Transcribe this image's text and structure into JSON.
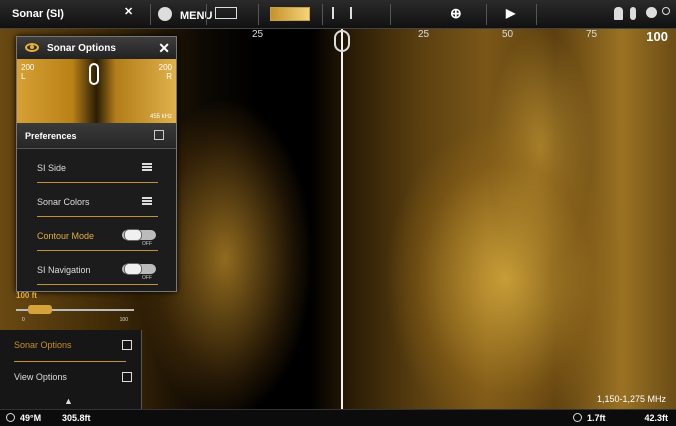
{
  "topbar": {
    "title": "Sonar (SI)",
    "close_glyph": "✕",
    "menu_label": "MENU",
    "play_glyph": "▶",
    "crosshair_glyph": "⊕",
    "icons": [
      "close-icon",
      "menu-icon",
      "chart-icon",
      "sonar-view-icon",
      "transducer-icon",
      "waypoint-icon",
      "play-icon",
      "person-icon",
      "gps-icon",
      "settings-icon"
    ],
    "accent": "#e8b330"
  },
  "scale": {
    "ticks": [
      "25",
      "25",
      "50",
      "75"
    ],
    "max": "100"
  },
  "panel": {
    "title": "Sonar Options",
    "close_glyph": "✕",
    "preview": {
      "left_top": "200",
      "left_unit": "L",
      "right_top": "200",
      "right_unit": "R",
      "freq": "455 kHz"
    },
    "preferences_label": "Preferences",
    "rows": [
      {
        "label": "SI Side",
        "control": "menu"
      },
      {
        "label": "Sonar Colors",
        "control": "menu"
      },
      {
        "label": "Contour Mode",
        "control": "toggle",
        "state": "OFF",
        "highlighted": true
      },
      {
        "label": "SI Navigation",
        "control": "toggle",
        "state": "OFF"
      }
    ]
  },
  "range": {
    "value": "100 ft",
    "min": "0",
    "max": "100"
  },
  "side_menu": {
    "items": [
      {
        "label": "Sonar Options",
        "active": true
      },
      {
        "label": "View Options",
        "active": false
      }
    ],
    "up_glyph": "▲"
  },
  "bottombar": {
    "water_temp": "49°M",
    "distance": "305.8ft",
    "speed": "1.7ft",
    "depth": "42.3ft"
  },
  "frequency": "1,150-1,275 MHz"
}
